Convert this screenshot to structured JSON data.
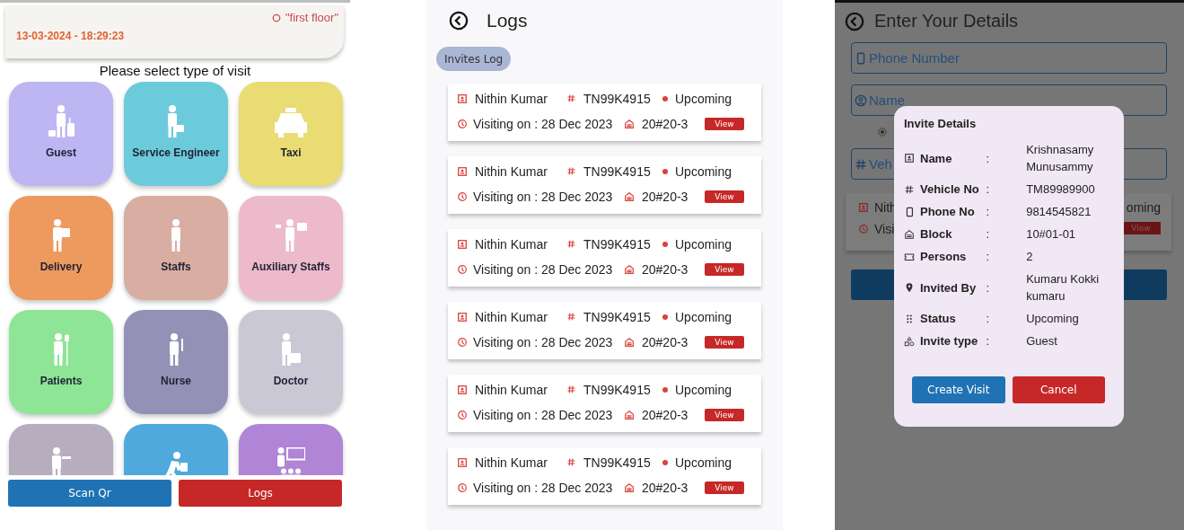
{
  "visit_screen": {
    "date_time": "13-03-2024 -  18:29:23",
    "location": "\"first floor\"",
    "heading": "Please select type of visit",
    "visit_types": [
      {
        "label": "Guest",
        "color": "#bdb6f2"
      },
      {
        "label": "Service Engineer",
        "color": "#6ccbdb"
      },
      {
        "label": "Taxi",
        "color": "#e8dc73"
      },
      {
        "label": "Delivery",
        "color": "#ee9a5f"
      },
      {
        "label": "Staffs",
        "color": "#d8ada2"
      },
      {
        "label": "Auxiliary Staffs",
        "color": "#ecbacb"
      },
      {
        "label": "Patients",
        "color": "#8de595"
      },
      {
        "label": "Nurse",
        "color": "#9391b6"
      },
      {
        "label": "Doctor",
        "color": "#cbc8d6"
      },
      {
        "color": "#b6adbf"
      },
      {
        "color": "#4fa9dc"
      },
      {
        "color": "#b084d6"
      }
    ],
    "buttons": [
      "Scan Qr",
      "Logs"
    ]
  },
  "logs_screen": {
    "title": "Logs",
    "chip": "Invites Log",
    "invites": [
      {
        "name": "Nithin Kumar",
        "vehicle_no": "TN99K4915",
        "status": "Upcoming",
        "visiting_on": "Visiting on : 28 Dec 2023",
        "block": "20#20-3",
        "button": "View"
      },
      {
        "name": "Nithin Kumar",
        "vehicle_no": "TN99K4915",
        "status": "Upcoming",
        "visiting_on": "Visiting on : 28 Dec 2023",
        "block": "20#20-3",
        "button": "View"
      },
      {
        "name": "Nithin Kumar",
        "vehicle_no": "TN99K4915",
        "status": "Upcoming",
        "visiting_on": "Visiting on : 28 Dec 2023",
        "block": "20#20-3",
        "button": "View"
      },
      {
        "name": "Nithin Kumar",
        "vehicle_no": "TN99K4915",
        "status": "Upcoming",
        "visiting_on": "Visiting on : 28 Dec 2023",
        "block": "20#20-3",
        "button": "View"
      },
      {
        "name": "Nithin Kumar",
        "vehicle_no": "TN99K4915",
        "status": "Upcoming",
        "visiting_on": "Visiting on : 28 Dec 2023",
        "block": "20#20-3",
        "button": "View"
      },
      {
        "name": "Nithin Kumar",
        "vehicle_no": "TN99K4915",
        "status": "Upcoming",
        "visiting_on": "Visiting on : 28 Dec 2023",
        "block": "20#20-3",
        "button": "View"
      }
    ]
  },
  "details_screen": {
    "title": "Enter Your Details",
    "fields": [
      {
        "placeholder": "Phone Number"
      },
      {
        "placeholder": "Name"
      },
      {
        "placeholder": "Veh"
      }
    ],
    "radio_option": {
      "selected": true
    },
    "background_card": {
      "name": "Nith",
      "visiting_on": "Visi",
      "status": "oming",
      "button": "View"
    },
    "dialog": {
      "title": "Invite Details",
      "rows": [
        {
          "label": "Name",
          "separator": ":",
          "value": "Krishnasamy Munusammy"
        },
        {
          "label": "Vehicle No",
          "separator": ":",
          "value": "TM89989900"
        },
        {
          "label": "Phone No",
          "separator": ":",
          "value": "9814545821"
        },
        {
          "label": "Block",
          "separator": ":",
          "value": "10#01-01"
        },
        {
          "label": "Persons",
          "separator": ":",
          "value": "2"
        },
        {
          "label": "Invited By",
          "separator": ":",
          "value": "Kumaru Kokki kumaru"
        },
        {
          "label": "Status",
          "separator": ":",
          "value": "Upcoming"
        },
        {
          "label": "Invite type",
          "separator": ":",
          "value": "Guest"
        }
      ],
      "buttons": [
        "Create Visit",
        "Cancel"
      ]
    }
  }
}
